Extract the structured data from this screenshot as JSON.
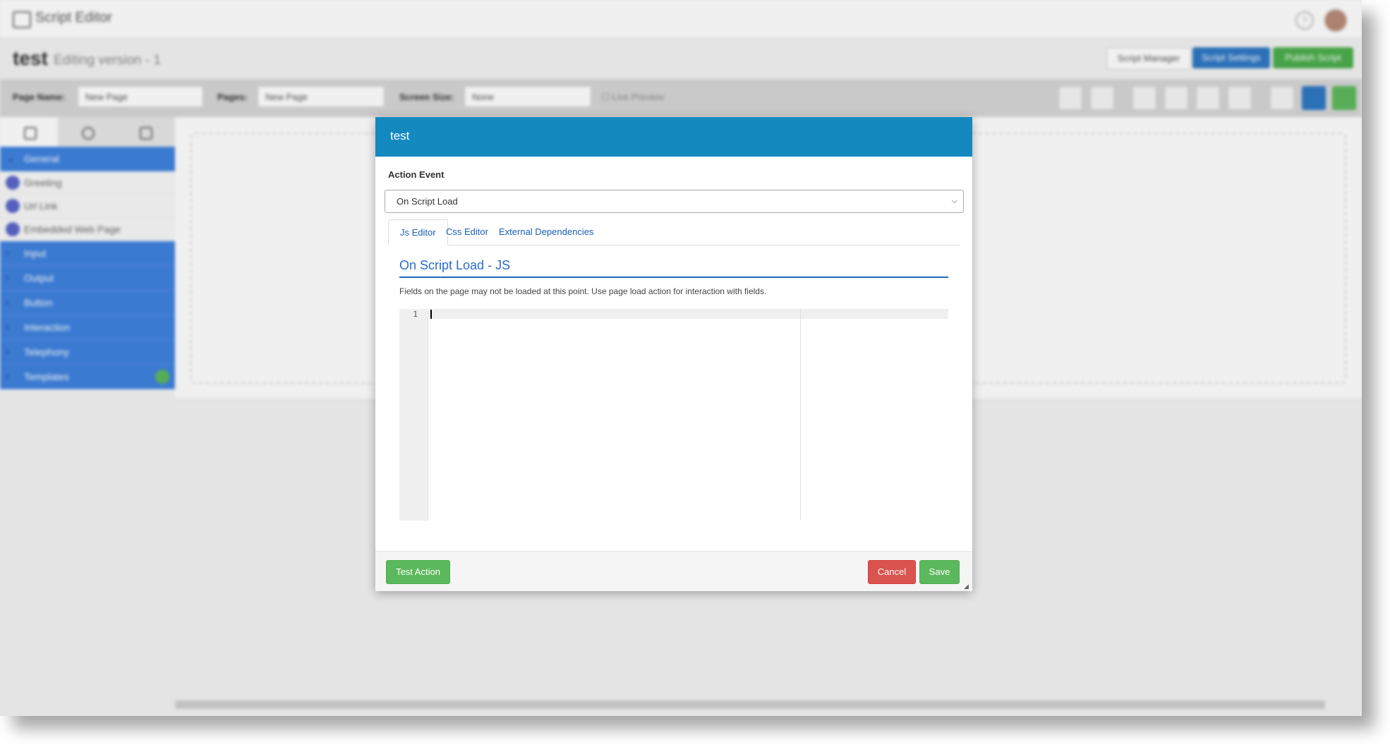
{
  "app": {
    "title": "Script Editor",
    "document_name": "test",
    "version_text": "Editing version - 1",
    "header_buttons": {
      "script_manager": "Script Manager",
      "script_settings": "Script Settings",
      "publish_script": "Publish Script"
    },
    "toolbar": {
      "page_name_label": "Page Name:",
      "page_name_value": "New Page",
      "pages_label": "Pages:",
      "pages_value": "New Page",
      "screen_size_label": "Screen Size:",
      "screen_size_value": "None",
      "live_preview_label": "Live Preview"
    },
    "sidebar": {
      "categories": [
        "General",
        "Input",
        "Output",
        "Button",
        "Interaction",
        "Telephony",
        "Templates"
      ],
      "general_items": [
        "Greeting",
        "Url Link",
        "Embedded Web Page"
      ]
    }
  },
  "modal": {
    "title": "test",
    "action_event_label": "Action Event",
    "action_event_value": "On Script Load",
    "tabs": [
      "Js Editor",
      "Css Editor",
      "External Dependencies"
    ],
    "active_tab": "Js Editor",
    "section_title": "On Script Load - JS",
    "note": "Fields on the page may not be loaded at this point. Use page load action for interaction with fields.",
    "editor": {
      "line_number": "1"
    },
    "buttons": {
      "test_action": "Test Action",
      "cancel": "Cancel",
      "save": "Save"
    }
  },
  "colors": {
    "modal_header": "#1389c0",
    "primary_blue": "#2f78c4",
    "success_green": "#5cb85c",
    "danger_red": "#d9534f",
    "sidebar_category": "#3f82df"
  }
}
